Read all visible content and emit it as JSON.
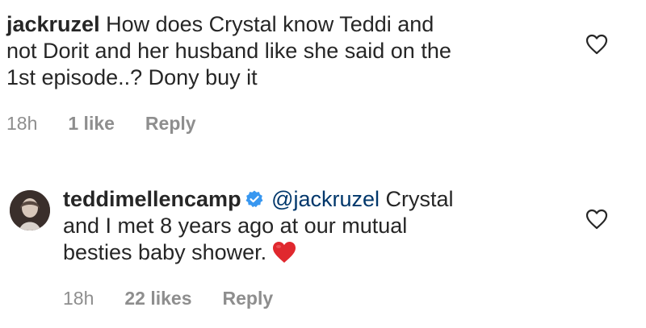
{
  "comments": [
    {
      "username": "jackruzel",
      "text": "How does Crystal know Teddi and not Dorit and her husband like she said on the 1st episode..? Dony buy it",
      "line1": "How does Crystal know Teddi and",
      "line2": "not Dorit and her husband like she said on the",
      "line3": "1st episode..? Dony buy it",
      "time": "18h",
      "likes": "1 like",
      "reply": "Reply",
      "liked": false
    },
    {
      "username": "teddimellencamp",
      "verified": true,
      "mention": "@jackruzel",
      "line1": "Crystal",
      "line2": "and I met 8 years ago at our mutual",
      "line3": "besties baby shower.",
      "emoji": "red-heart",
      "time": "18h",
      "likes": "22 likes",
      "reply": "Reply",
      "liked": false
    }
  ],
  "colors": {
    "text": "#262626",
    "meta": "#8e8e8e",
    "mention": "#00376b",
    "verified": "#3897f0",
    "heart_emoji": "#e0282e"
  }
}
